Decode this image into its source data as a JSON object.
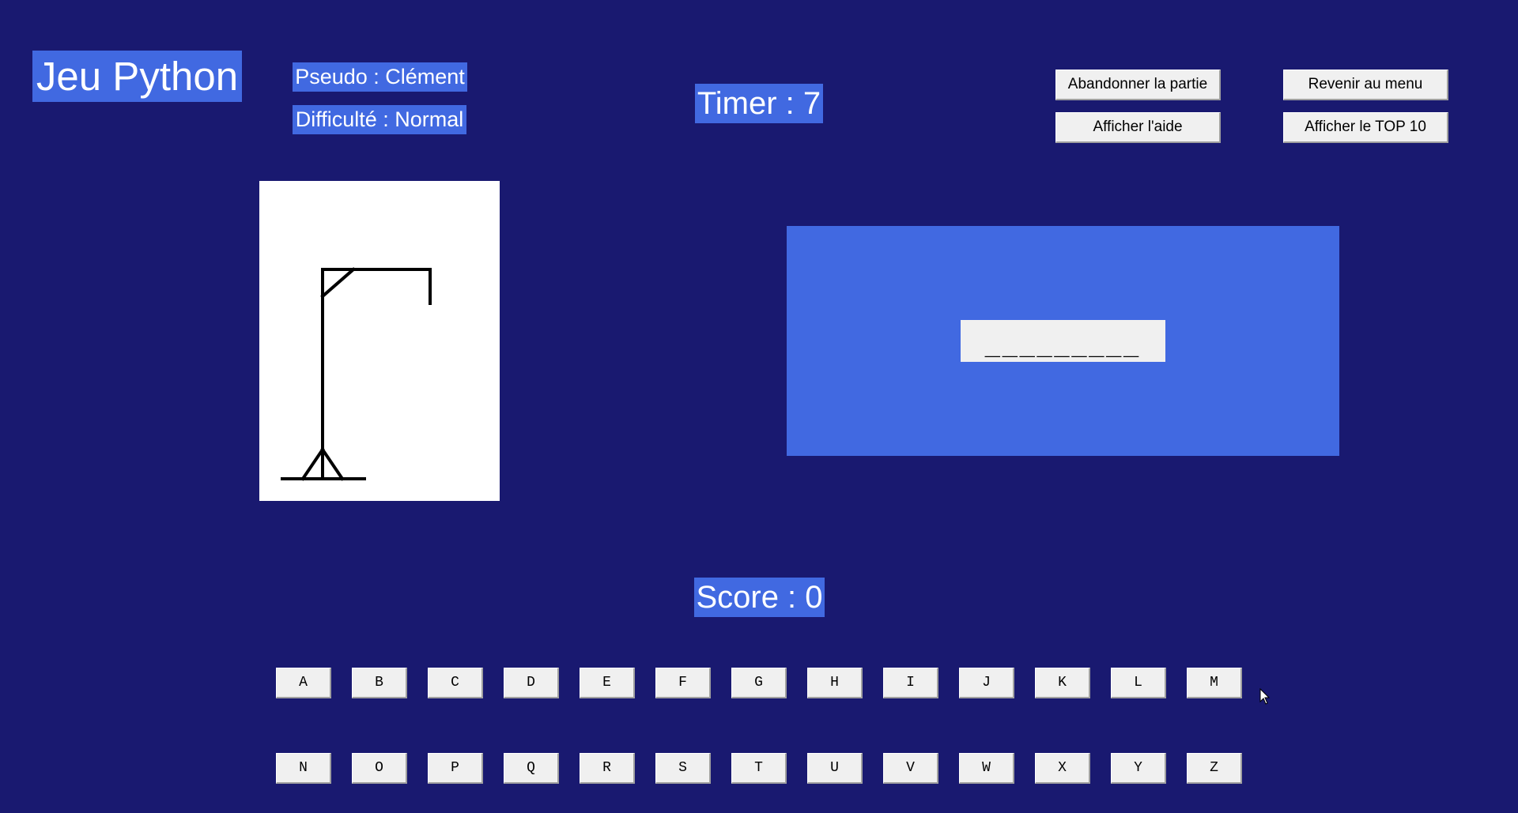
{
  "header": {
    "title": "Jeu Python",
    "pseudo": "Pseudo : Clément",
    "difficulty": "Difficulté : Normal",
    "timer": "Timer : 7"
  },
  "buttons": {
    "abandon": "Abandonner la partie",
    "menu": "Revenir au menu",
    "help": "Afficher l'aide",
    "top10": "Afficher le TOP 10"
  },
  "game": {
    "hidden_word": "_________",
    "hangman_stage_icon": "gallows-stage-icon",
    "score": "Score : 0"
  },
  "keyboard": {
    "row1": [
      "A",
      "B",
      "C",
      "D",
      "E",
      "F",
      "G",
      "H",
      "I",
      "J",
      "K",
      "L",
      "M"
    ],
    "row2": [
      "N",
      "O",
      "P",
      "Q",
      "R",
      "S",
      "T",
      "U",
      "V",
      "W",
      "X",
      "Y",
      "Z"
    ]
  },
  "colors": {
    "background": "#191970",
    "label_background": "#4169e1",
    "button_face": "#f0f0f0"
  }
}
